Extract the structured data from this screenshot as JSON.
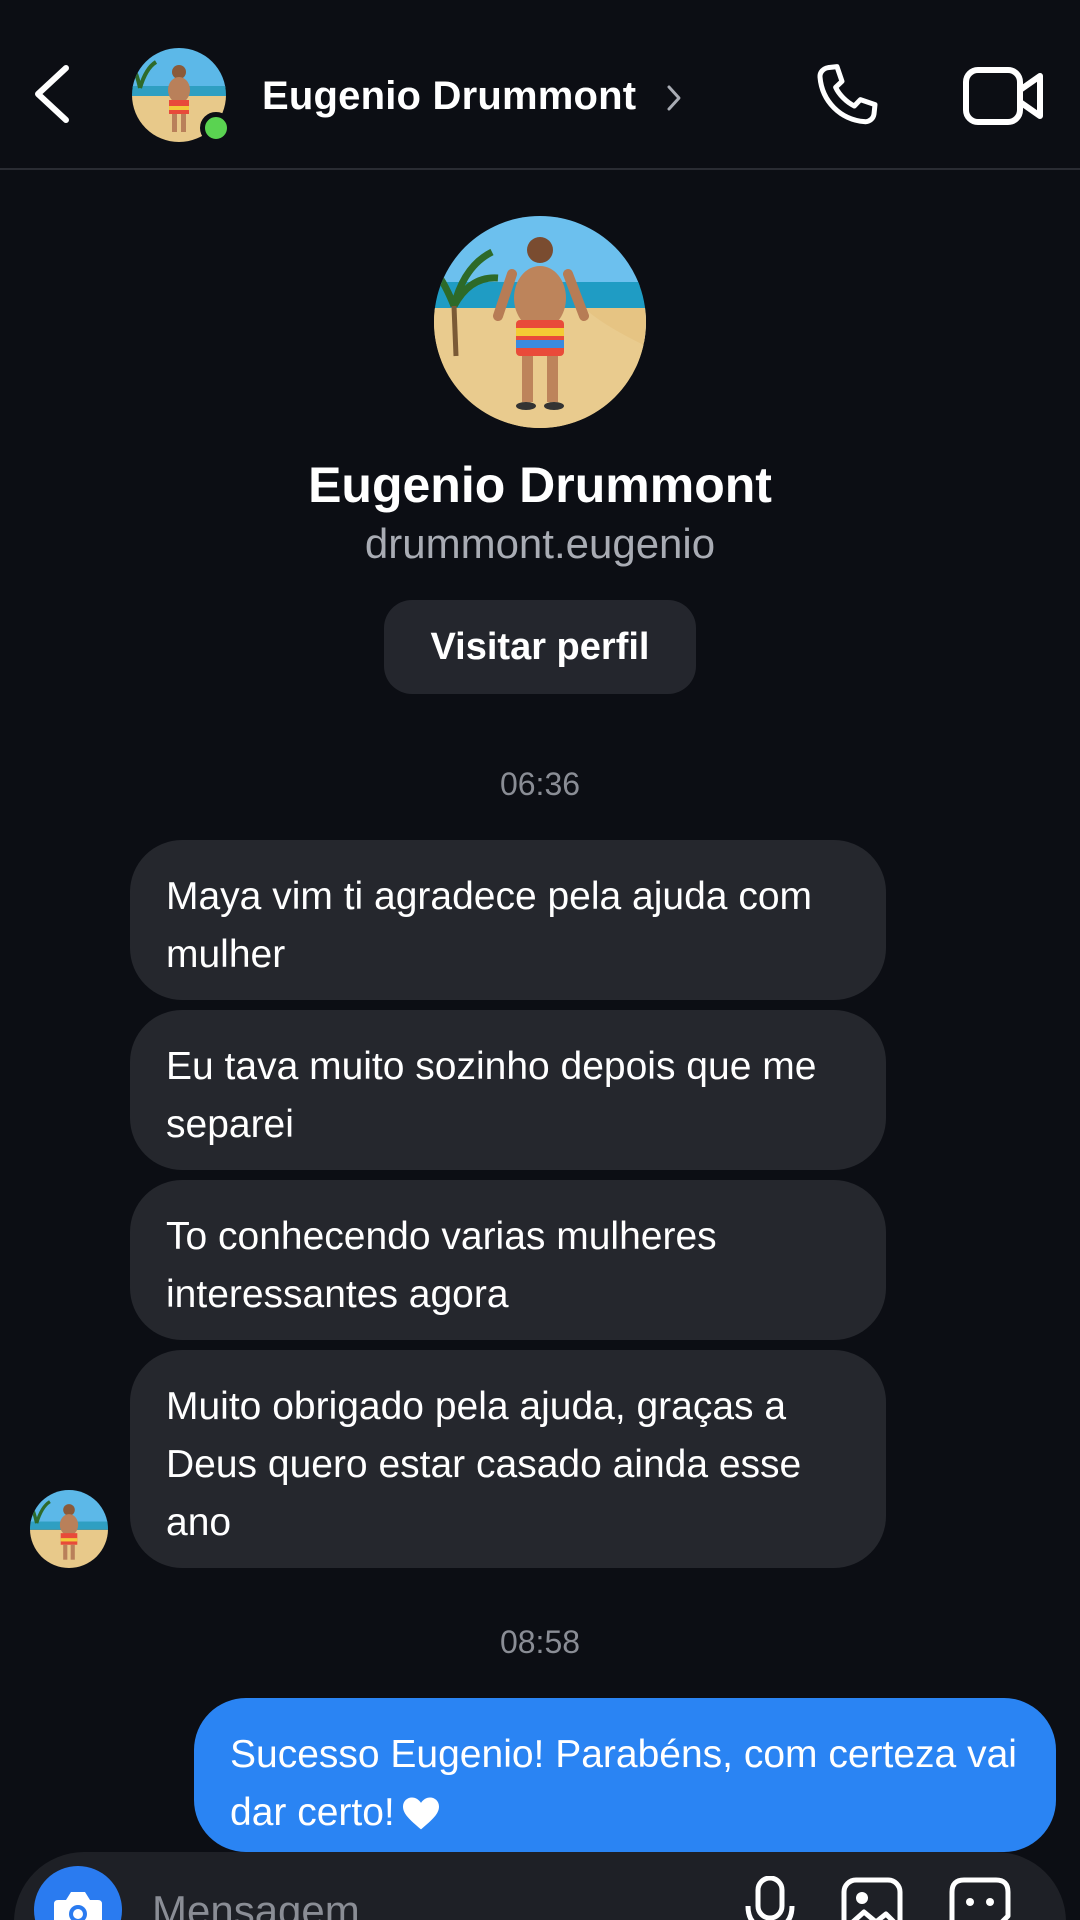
{
  "header": {
    "contact_name": "Eugenio Drummont",
    "online": true
  },
  "profile": {
    "name": "Eugenio Drummont",
    "username": "drummont.eugenio",
    "visit_button_label": "Visitar perfil"
  },
  "messages": [
    {
      "time": "06:36"
    },
    {
      "direction": "incoming",
      "text": "Maya vim ti agradece pela ajuda com mulher"
    },
    {
      "direction": "incoming",
      "text": "Eu tava muito sozinho depois que me separei"
    },
    {
      "direction": "incoming",
      "text": "To conhecendo varias mulheres interessantes agora"
    },
    {
      "direction": "incoming",
      "text": "Muito obrigado pela ajuda, graças a Deus quero estar casado ainda esse ano"
    },
    {
      "time": "08:58"
    },
    {
      "direction": "outgoing",
      "text": "Sucesso Eugenio! Parabéns, com certeza vai dar certo!",
      "emoji": "white-heart"
    }
  ],
  "composer": {
    "placeholder": "Mensagem"
  },
  "icons": {
    "back": "chevron-left-icon",
    "call": "phone-icon",
    "video": "video-camera-icon",
    "camera": "camera-icon",
    "mic": "microphone-icon",
    "gallery": "image-icon",
    "sticker": "sticker-icon"
  },
  "colors": {
    "background": "#0c0e14",
    "incoming_bubble": "#25272d",
    "outgoing_bubble": "#2a84f3",
    "online_dot": "#5ad351",
    "camera_button": "#2a7bf0"
  }
}
